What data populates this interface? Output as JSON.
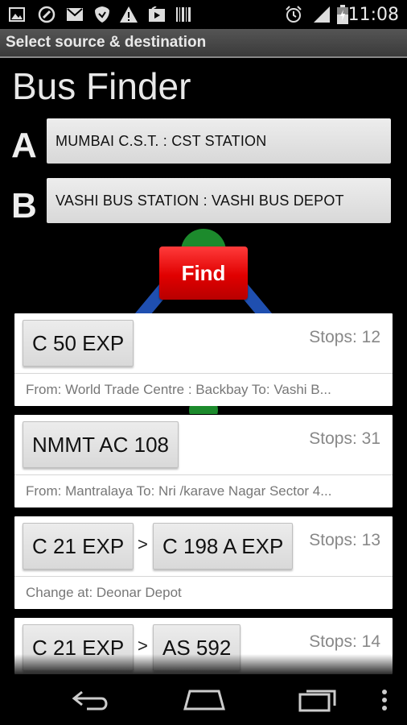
{
  "status_bar": {
    "time": "11:08",
    "icons": [
      "picture-icon",
      "sync-icon",
      "gmail-icon",
      "shield-icon",
      "warning-icon",
      "youtube-icon",
      "barcode-icon",
      "alarm-icon",
      "signal-icon",
      "battery-charging-icon"
    ]
  },
  "header": {
    "title": "Select source & destination"
  },
  "app": {
    "title": "Bus Finder",
    "label_a": "A",
    "label_b": "B",
    "source": "MUMBAI C.S.T. : CST STATION",
    "destination": "VASHI BUS STATION : VASHI BUS DEPOT",
    "find_label": "Find"
  },
  "results": [
    {
      "routes": [
        "C 50 EXP"
      ],
      "stops": "Stops: 12",
      "detail": "From: World Trade Centre : Backbay To: Vashi B..."
    },
    {
      "routes": [
        "NMMT AC 108"
      ],
      "stops": "Stops: 31",
      "detail": "From: Mantralaya To: Nri /karave Nagar Sector 4..."
    },
    {
      "routes": [
        "C 21 EXP",
        "C 198 A EXP"
      ],
      "separator": ">",
      "stops": "Stops: 13",
      "detail": "Change at:  Deonar Depot"
    },
    {
      "routes": [
        "C 21 EXP",
        "AS 592"
      ],
      "separator": ">",
      "stops": "Stops: 14"
    }
  ],
  "colors": {
    "find_button": "#e00000",
    "background": "#000000",
    "card": "#ffffff"
  },
  "nav": [
    "back-icon",
    "home-icon",
    "recent-apps-icon",
    "overflow-menu-icon"
  ]
}
